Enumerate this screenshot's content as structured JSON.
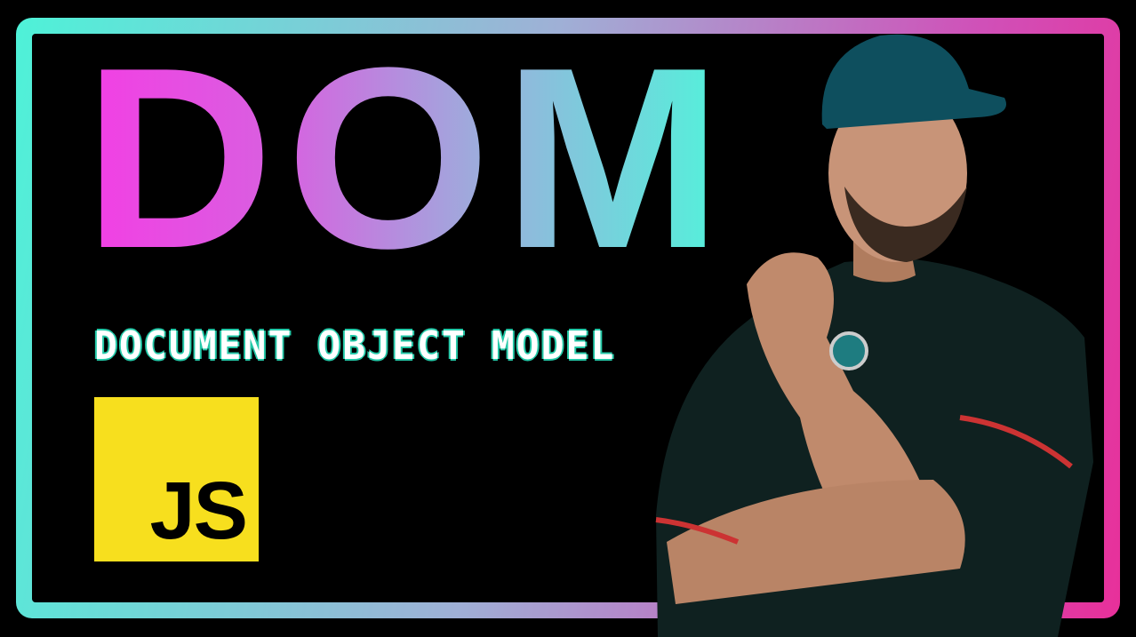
{
  "title": "DOM",
  "subtitle": "DOCUMENT OBJECT MODEL",
  "logo": {
    "text": "JS",
    "color": "#f7df1e"
  },
  "colors": {
    "gradient_start": "#f33ee4",
    "gradient_end": "#4ff5db",
    "frame_start": "#4ef2d8",
    "frame_end": "#e8309a"
  },
  "person_image": "man-in-cap-photo"
}
